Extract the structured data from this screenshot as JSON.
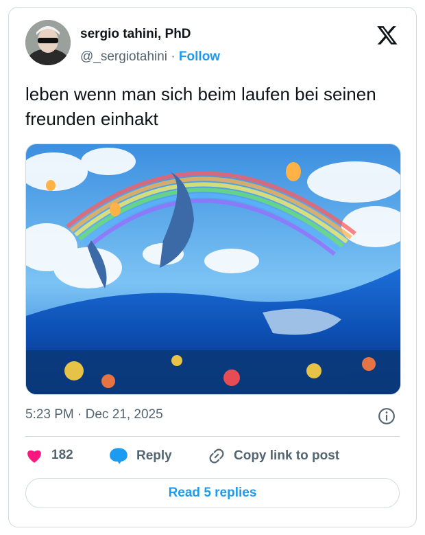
{
  "author": {
    "display_name": "sergio tahini, PhD",
    "handle": "@_sergiotahini",
    "separator": "·",
    "follow_label": "Follow",
    "avatar_icon": "avatar-photo"
  },
  "platform_icon": "x-logo-icon",
  "tweet": {
    "text": "leben wenn man sich beim laufen bei seinen freunden einhakt",
    "media_description": "dolphins-rainbow-ocean-artwork"
  },
  "meta": {
    "timestamp": "5:23 PM · Dec 21, 2025"
  },
  "actions": {
    "like_count": "182",
    "reply_label": "Reply",
    "copy_link_label": "Copy link to post"
  },
  "read_replies_label": "Read 5 replies",
  "colors": {
    "accent": "#1d9bf0",
    "like": "#f91880",
    "text": "#0f1419",
    "muted": "#536471",
    "border": "#cfd9de"
  }
}
